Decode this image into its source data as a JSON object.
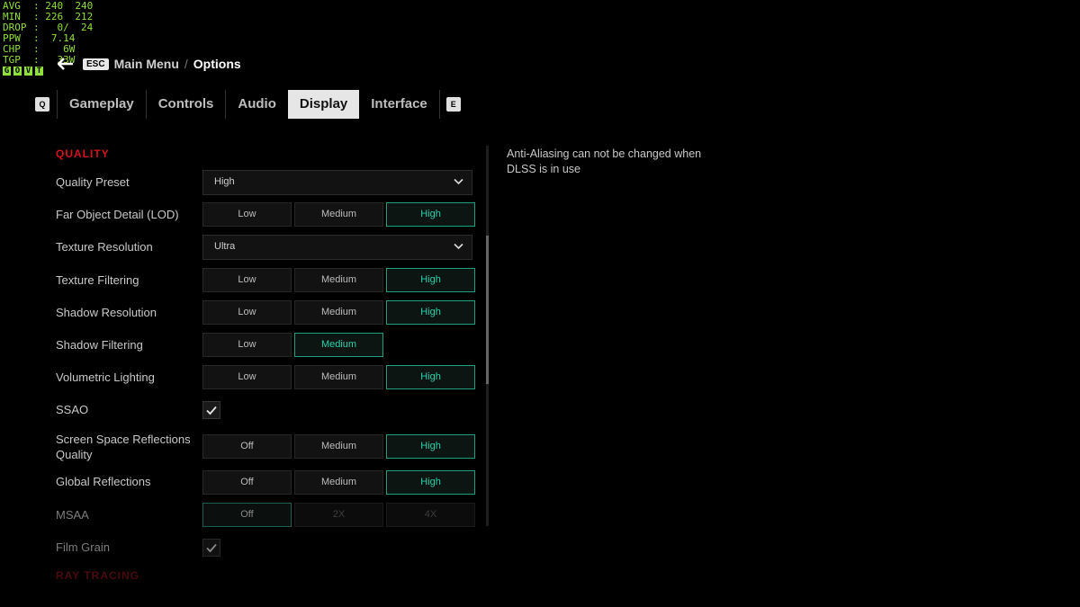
{
  "overlay": {
    "rows": [
      {
        "k": "AVG",
        "v": ": 240  240"
      },
      {
        "k": "MIN",
        "v": ": 226  212"
      },
      {
        "k": "DROP",
        "v": ":   0/  24"
      },
      {
        "k": "PPW",
        "v": ":  7.14"
      },
      {
        "k": "CHP",
        "v": ":    6W"
      },
      {
        "k": "TGP",
        "v": ":   33W"
      }
    ],
    "flags": [
      "G",
      "O",
      "V",
      "T"
    ],
    "color": "#8fe03a"
  },
  "breadcrumb": {
    "back_icon": "arrow-left-icon",
    "esc_key": "ESC",
    "main": "Main Menu",
    "sep": "/",
    "current": "Options"
  },
  "tabs": {
    "prev_key": "Q",
    "next_key": "E",
    "items": [
      {
        "label": "Gameplay"
      },
      {
        "label": "Controls"
      },
      {
        "label": "Audio"
      },
      {
        "label": "Display",
        "active": true
      },
      {
        "label": "Interface"
      }
    ]
  },
  "section_quality": "QUALITY",
  "section_raytracing": "RAY TRACING",
  "settings": {
    "quality_preset": {
      "label": "Quality Preset",
      "value": "High"
    },
    "far_object_detail": {
      "label": "Far Object Detail (LOD)",
      "options": [
        "Low",
        "Medium",
        "High"
      ],
      "selected": "High"
    },
    "texture_resolution": {
      "label": "Texture Resolution",
      "value": "Ultra"
    },
    "texture_filtering": {
      "label": "Texture Filtering",
      "options": [
        "Low",
        "Medium",
        "High"
      ],
      "selected": "High"
    },
    "shadow_resolution": {
      "label": "Shadow Resolution",
      "options": [
        "Low",
        "Medium",
        "High"
      ],
      "selected": "High"
    },
    "shadow_filtering": {
      "label": "Shadow Filtering",
      "options": [
        "Low",
        "Medium"
      ],
      "selected": "Medium"
    },
    "volumetric_lighting": {
      "label": "Volumetric Lighting",
      "options": [
        "Low",
        "Medium",
        "High"
      ],
      "selected": "High"
    },
    "ssao": {
      "label": "SSAO",
      "checked": true
    },
    "ssr_quality": {
      "label_line1": "Screen Space Reflections",
      "label_line2": "Quality",
      "options": [
        "Off",
        "Medium",
        "High"
      ],
      "selected": "High"
    },
    "global_reflections": {
      "label": "Global Reflections",
      "options": [
        "Off",
        "Medium",
        "High"
      ],
      "selected": "High"
    },
    "msaa": {
      "label": "MSAA",
      "options": [
        "Off",
        "2X",
        "4X"
      ],
      "selected": "Off",
      "disabled": true
    },
    "film_grain": {
      "label": "Film Grain",
      "checked": true
    }
  },
  "info_text": "Anti-Aliasing can not be changed when DLSS is in use",
  "accent_color": "#29d2ac",
  "section_color": "#d3131d"
}
